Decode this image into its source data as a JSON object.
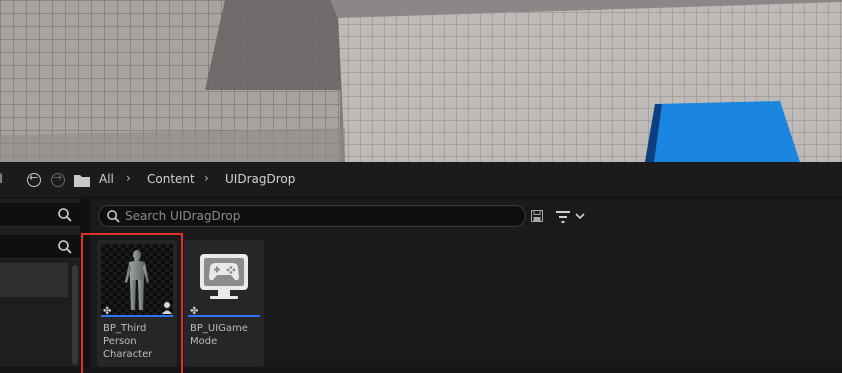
{
  "breadcrumb": {
    "left_fragment": "ll",
    "items": [
      "All",
      "Content",
      "UIDragDrop"
    ],
    "separator": "›"
  },
  "search": {
    "placeholder": "Search UIDragDrop"
  },
  "assets": [
    {
      "name": "BP_ThirdPersonCharacter",
      "label_lines": [
        "BP_Third",
        "Person",
        "Character"
      ],
      "type_icon": "character-icon"
    },
    {
      "name": "BP_UIGameMode",
      "label_lines": [
        "BP_UIGame",
        "Mode"
      ],
      "type_icon": "gamepad-monitor-icon"
    }
  ],
  "colors": {
    "selection_outline": "#e0312c",
    "blueprint_bar": "#2e74f3",
    "viewport_cube": "#1b86e0"
  }
}
